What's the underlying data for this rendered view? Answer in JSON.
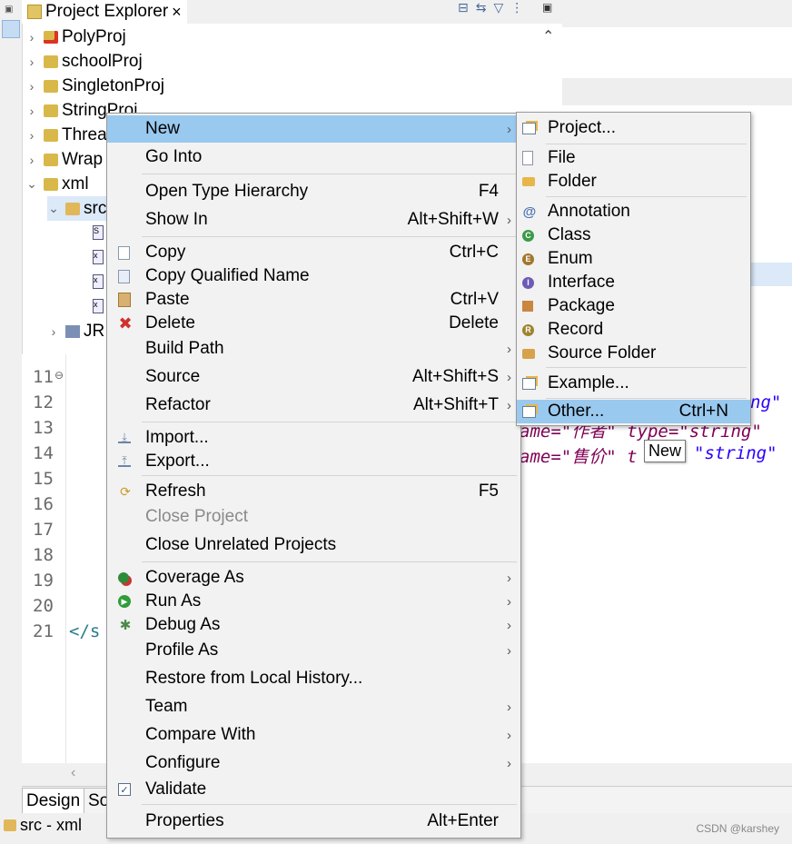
{
  "explorer": {
    "tab_title": "Project Explorer",
    "tab_close": "×",
    "toolbar": [
      "⊟",
      "⇆",
      "▽",
      "⋮"
    ],
    "tree": [
      {
        "label": "PolyProj",
        "chev": "›"
      },
      {
        "label": "schoolProj",
        "chev": "›"
      },
      {
        "label": "SingletonProj",
        "chev": "›"
      },
      {
        "label": "StringProj",
        "chev": "›"
      },
      {
        "label": "Threa",
        "chev": "›"
      },
      {
        "label": "Wrap",
        "chev": "›"
      },
      {
        "label": "xml",
        "chev": "⌄"
      },
      {
        "label": "src",
        "chev": "⌄"
      },
      {
        "label": "JR",
        "chev": "›"
      }
    ]
  },
  "editor": {
    "line_numbers": [
      "11",
      "12",
      "13",
      "14",
      "15",
      "16",
      "17",
      "18",
      "19",
      "20",
      "21"
    ],
    "fold_marker": "⊖",
    "code_line_21": "</s",
    "code_fragments": [
      "ng\"",
      "ame=\"作者\" type=\"string\"",
      "ame=\"售价\" t",
      "\"string\""
    ]
  },
  "bottom_tabs": [
    "Design",
    "So"
  ],
  "status": {
    "label": "src - xml"
  },
  "watermark": "CSDN @karshey",
  "context_menu": {
    "items": [
      {
        "label": "New",
        "accel": "",
        "submenu": true,
        "icon": "",
        "highlighted": true
      },
      {
        "label": "Go Into",
        "accel": "",
        "submenu": false,
        "icon": ""
      },
      {
        "label": "Open Type Hierarchy",
        "accel": "F4",
        "submenu": false,
        "icon": ""
      },
      {
        "label": "Show In",
        "accel": "Alt+Shift+W",
        "submenu": true,
        "icon": ""
      },
      {
        "label": "Copy",
        "accel": "Ctrl+C",
        "submenu": false,
        "icon": "copy-icon"
      },
      {
        "label": "Copy Qualified Name",
        "accel": "",
        "submenu": false,
        "icon": "copy-qualified-icon"
      },
      {
        "label": "Paste",
        "accel": "Ctrl+V",
        "submenu": false,
        "icon": "paste-icon"
      },
      {
        "label": "Delete",
        "accel": "Delete",
        "submenu": false,
        "icon": "delete-icon"
      },
      {
        "label": "Build Path",
        "accel": "",
        "submenu": true,
        "icon": ""
      },
      {
        "label": "Source",
        "accel": "Alt+Shift+S",
        "submenu": true,
        "icon": ""
      },
      {
        "label": "Refactor",
        "accel": "Alt+Shift+T",
        "submenu": true,
        "icon": ""
      },
      {
        "label": "Import...",
        "accel": "",
        "submenu": false,
        "icon": "import-icon"
      },
      {
        "label": "Export...",
        "accel": "",
        "submenu": false,
        "icon": "export-icon"
      },
      {
        "label": "Refresh",
        "accel": "F5",
        "submenu": false,
        "icon": "refresh-icon"
      },
      {
        "label": "Close Project",
        "accel": "",
        "submenu": false,
        "icon": "",
        "disabled": true
      },
      {
        "label": "Close Unrelated Projects",
        "accel": "",
        "submenu": false,
        "icon": ""
      },
      {
        "label": "Coverage As",
        "accel": "",
        "submenu": true,
        "icon": "coverage-icon"
      },
      {
        "label": "Run As",
        "accel": "",
        "submenu": true,
        "icon": "run-icon"
      },
      {
        "label": "Debug As",
        "accel": "",
        "submenu": true,
        "icon": "debug-icon"
      },
      {
        "label": "Profile As",
        "accel": "",
        "submenu": true,
        "icon": ""
      },
      {
        "label": "Restore from Local History...",
        "accel": "",
        "submenu": false,
        "icon": ""
      },
      {
        "label": "Team",
        "accel": "",
        "submenu": true,
        "icon": ""
      },
      {
        "label": "Compare With",
        "accel": "",
        "submenu": true,
        "icon": ""
      },
      {
        "label": "Configure",
        "accel": "",
        "submenu": true,
        "icon": ""
      },
      {
        "label": "Validate",
        "accel": "",
        "submenu": false,
        "icon": "checkbox-icon"
      },
      {
        "label": "Properties",
        "accel": "Alt+Enter",
        "submenu": false,
        "icon": ""
      }
    ],
    "arrow": "›"
  },
  "submenu": {
    "items": [
      {
        "label": "Project...",
        "accel": "",
        "icon": "project-icon"
      },
      {
        "label": "File",
        "accel": "",
        "icon": "file-icon"
      },
      {
        "label": "Folder",
        "accel": "",
        "icon": "folder-icon"
      },
      {
        "label": "Annotation",
        "accel": "",
        "icon": "annotation-icon"
      },
      {
        "label": "Class",
        "accel": "",
        "icon": "class-icon"
      },
      {
        "label": "Enum",
        "accel": "",
        "icon": "enum-icon"
      },
      {
        "label": "Interface",
        "accel": "",
        "icon": "interface-icon"
      },
      {
        "label": "Package",
        "accel": "",
        "icon": "package-icon"
      },
      {
        "label": "Record",
        "accel": "",
        "icon": "record-icon"
      },
      {
        "label": "Source Folder",
        "accel": "",
        "icon": "source-folder-icon"
      },
      {
        "label": "Example...",
        "accel": "",
        "icon": "example-icon"
      },
      {
        "label": "Other...",
        "accel": "Ctrl+N",
        "icon": "other-icon",
        "highlighted": true
      }
    ]
  },
  "tooltip": "New",
  "colors": {
    "highlight": "#99c9ef",
    "menu_bg": "#f2f2f2",
    "keyword_purple": "#7f0055",
    "string_blue": "#2a00ff"
  }
}
